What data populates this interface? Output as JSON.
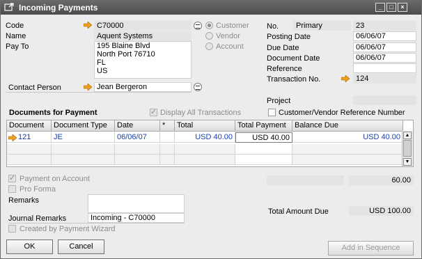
{
  "window": {
    "title": "Incoming Payments",
    "controls": [
      "_",
      "□",
      "×"
    ]
  },
  "bp": {
    "code_label": "Code",
    "code": "C70000",
    "name_label": "Name",
    "name": "Aquent Systems",
    "payto_label": "Pay To",
    "payto_lines": [
      "195 Blaine Blvd",
      "North Port 76710",
      "FL",
      "US"
    ],
    "contact_label": "Contact Person",
    "contact": "Jean Bergeron"
  },
  "type_options": {
    "customer": "Customer",
    "vendor": "Vendor",
    "account": "Account"
  },
  "header": {
    "no_label": "No.",
    "series": "Primary",
    "no": "23",
    "posting_date_label": "Posting Date",
    "posting_date": "06/06/07",
    "due_date_label": "Due Date",
    "due_date": "06/06/07",
    "document_date_label": "Document Date",
    "document_date": "06/06/07",
    "reference_label": "Reference",
    "reference": "",
    "transaction_label": "Transaction No.",
    "transaction": "124",
    "project_label": "Project",
    "project": ""
  },
  "docs": {
    "section_title": "Documents for Payment",
    "display_all": "Display All Transactions",
    "cv_ref": "Customer/Vendor Reference Number",
    "columns": [
      "Document",
      "Document Type",
      "Date",
      "*",
      "Total",
      "Total Payment",
      "Balance Due"
    ],
    "rows": [
      {
        "document": "121",
        "type": "JE",
        "date": "06/06/07",
        "star": "",
        "total": "USD 40.00",
        "total_payment": "USD 40.00",
        "balance_due": "USD 40.00"
      }
    ]
  },
  "footer": {
    "payment_on_account": "Payment on Account",
    "pro_forma": "Pro Forma",
    "remarks_label": "Remarks",
    "remarks": "",
    "journal_remarks_label": "Journal Remarks",
    "journal_remarks": "Incoming - C70000",
    "created_wizard": "Created by Payment Wizard",
    "amount_left": "",
    "amount_right": "60.00",
    "total_due_label": "Total Amount Due",
    "total_due": "USD 100.00"
  },
  "buttons": {
    "ok": "OK",
    "cancel": "Cancel",
    "add_in_sequence": "Add in Sequence"
  }
}
